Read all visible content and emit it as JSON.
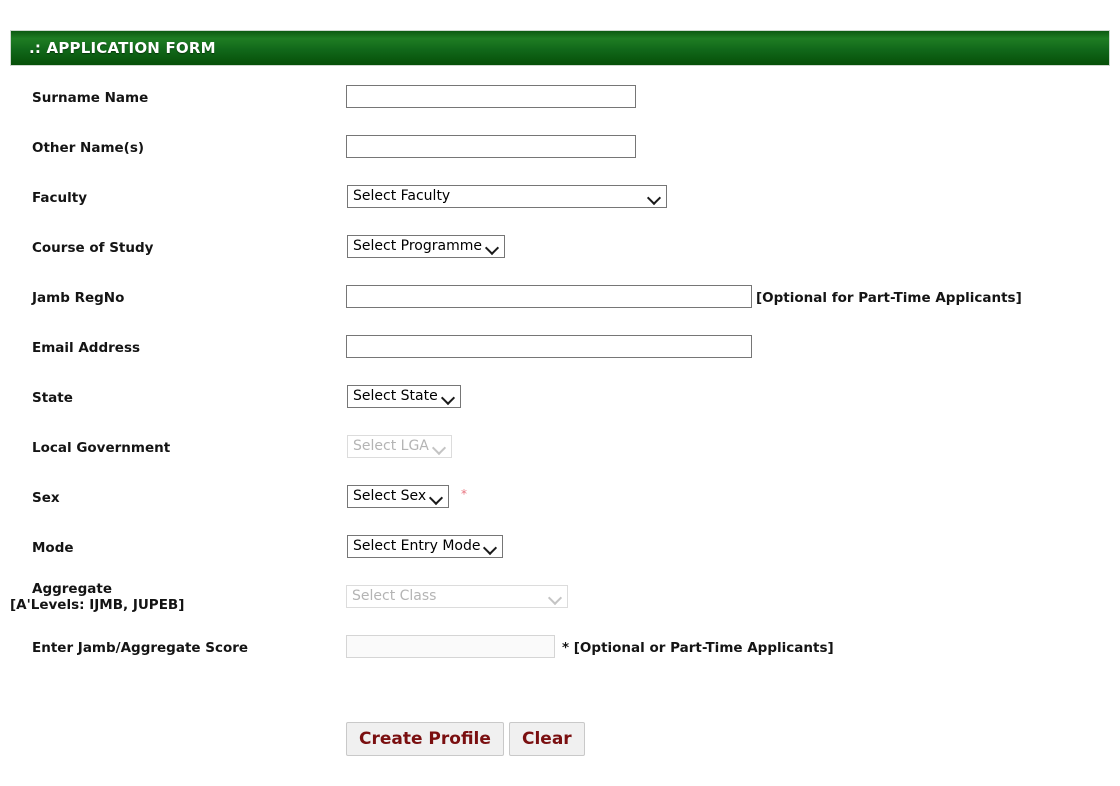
{
  "panel": {
    "title": ".: APPLICATION FORM"
  },
  "form": {
    "fields": [
      {
        "label": "Surname Name",
        "type": "text",
        "value": "",
        "placeholder": ""
      },
      {
        "label": "Other Name(s)",
        "type": "text",
        "value": "",
        "placeholder": ""
      },
      {
        "label": "Faculty",
        "type": "select",
        "value": "Select Faculty"
      },
      {
        "label": "Course of Study",
        "type": "select",
        "value": "Select Programme"
      },
      {
        "label": "Jamb RegNo",
        "type": "text",
        "value": "",
        "placeholder": "",
        "note": "[Optional for Part-Time Applicants]"
      },
      {
        "label": "Email Address",
        "type": "text",
        "value": "",
        "placeholder": ""
      },
      {
        "label": "State",
        "type": "select",
        "value": "Select State"
      },
      {
        "label": "Local Government",
        "type": "select",
        "value": "Select LGA",
        "disabled": true
      },
      {
        "label": "Sex",
        "type": "select",
        "value": "Select Sex",
        "required_marker": "*"
      },
      {
        "label": "Mode",
        "type": "select",
        "value": "Select Entry Mode"
      },
      {
        "label_line1": "Aggregate",
        "label_line2": "[A'Levels: IJMB, JUPEB]",
        "type": "select",
        "value": "Select Class",
        "disabled": true
      },
      {
        "label": "Enter Jamb/Aggregate Score",
        "type": "text",
        "value": "",
        "placeholder": "",
        "disabled": true,
        "note": "* [Optional or Part-Time Applicants]"
      }
    ]
  },
  "buttons": {
    "create_profile": "Create Profile",
    "clear": "Clear"
  },
  "colors": {
    "panel_green_light": "#1f7d23",
    "panel_green_dark": "#064f08",
    "button_text": "#7a0f10",
    "required_asterisk": "#e8737f"
  }
}
